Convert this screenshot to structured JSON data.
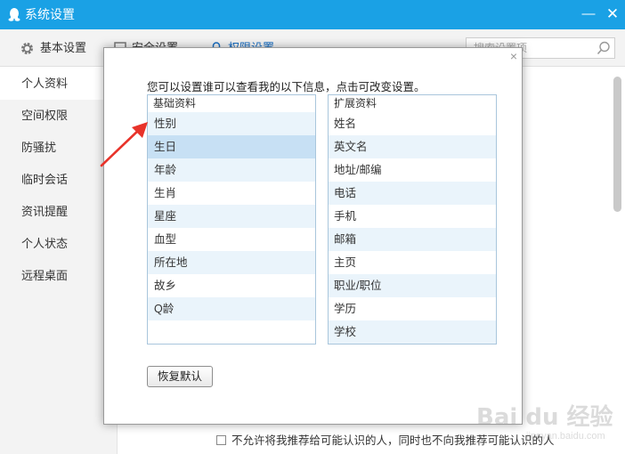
{
  "window": {
    "title": "系统设置",
    "minimize_glyph": "—",
    "close_glyph": "✕",
    "accent_color": "#1aa1e5"
  },
  "toolbar": {
    "tabs": [
      {
        "label": "基本设置",
        "icon": "gear-icon"
      },
      {
        "label": "安全设置",
        "icon": "shield-icon"
      },
      {
        "label": "权限设置",
        "icon": "lock-icon"
      }
    ],
    "search_placeholder": "搜索设置项"
  },
  "sidebar": {
    "items": [
      {
        "label": "个人资料",
        "active": true
      },
      {
        "label": "空间权限"
      },
      {
        "label": "防骚扰"
      },
      {
        "label": "临时会话"
      },
      {
        "label": "资讯提醒"
      },
      {
        "label": "个人状态"
      },
      {
        "label": "远程桌面"
      }
    ]
  },
  "bottom_option": "不允许将我推荐给可能认识的人，同时也不向我推荐可能认识的人",
  "dialog": {
    "close_glyph": "×",
    "intro": "您可以设置谁可以查看我的以下信息，点击可改变设置。",
    "basic": {
      "header": "基础资料",
      "items": [
        "性别",
        "生日",
        "年龄",
        "生肖",
        "星座",
        "血型",
        "所在地",
        "故乡",
        "Q龄"
      ],
      "selected": "生日"
    },
    "extended": {
      "header": "扩展资料",
      "items": [
        "姓名",
        "英文名",
        "地址/邮编",
        "电话",
        "手机",
        "邮箱",
        "主页",
        "职业/职位",
        "学历",
        "学校"
      ]
    },
    "reset_button": "恢复默认"
  },
  "watermark": {
    "brand": "Bai du 经验",
    "url": "jingyan.baidu.com"
  }
}
